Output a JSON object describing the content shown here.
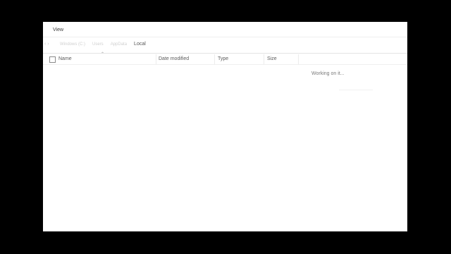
{
  "ribbon": {
    "view_tab": "View"
  },
  "address_bar": {
    "back_icon": "back-arrow-icon",
    "breadcrumbs": [
      "Windows (C:)",
      "Users",
      "AppData"
    ],
    "current": "Local"
  },
  "columns": {
    "name": "Name",
    "date_modified": "Date modified",
    "type": "Type",
    "size": "Size"
  },
  "status": {
    "text": "Working on it..."
  },
  "colors": {
    "background": "#000000",
    "window": "#ffffff"
  }
}
